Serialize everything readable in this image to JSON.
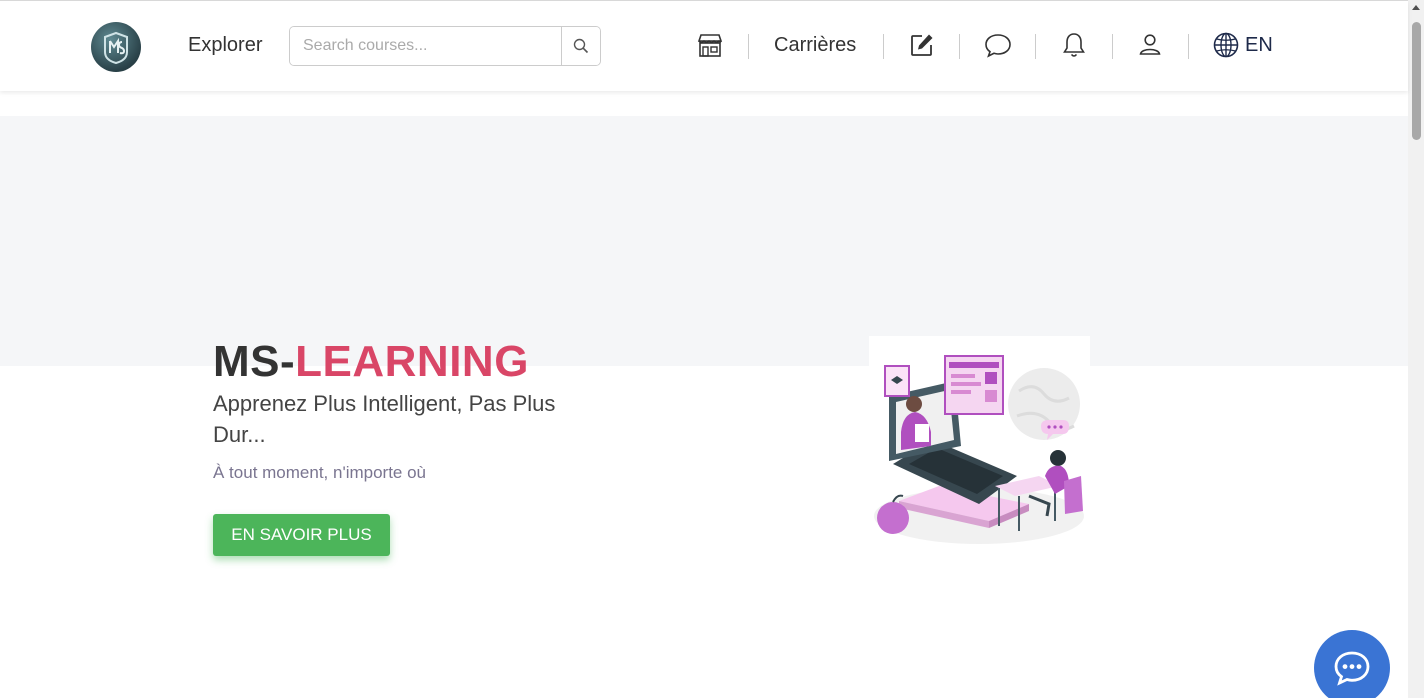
{
  "header": {
    "logo_text": "MS",
    "explorer_label": "Explorer",
    "search": {
      "placeholder": "Search courses...",
      "value": ""
    },
    "careers_label": "Carrières",
    "language_label": "EN",
    "icons": [
      "store-icon",
      "edit-icon",
      "chat-bubble-icon",
      "bell-icon",
      "user-icon",
      "globe-icon",
      "search-icon"
    ]
  },
  "hero": {
    "title_prefix": "MS-",
    "title_accent": "LEARNING",
    "subtitle": "Apprenez Plus Intelligent, Pas Plus Dur...",
    "tagline": "À tout moment, n'importe où",
    "cta_label": "EN SAVOIR PLUS"
  },
  "colors": {
    "accent": "#d94667",
    "cta": "#4cb55a",
    "chat_button": "#3a74d4",
    "illustration": "#b04fbf"
  }
}
